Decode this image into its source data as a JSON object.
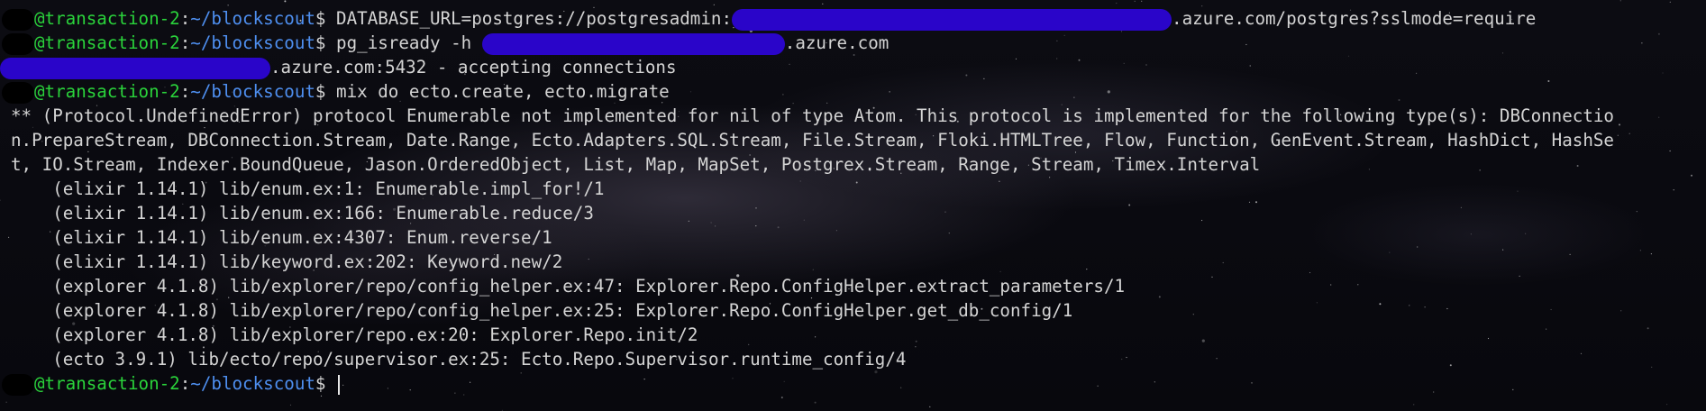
{
  "terminal": {
    "user": "@transaction-2",
    "cwd": "~/blockscout",
    "prompt_symbol": "$",
    "colors": {
      "user": "#2ad33b",
      "path": "#4e8ff0",
      "text": "#d4d4d4",
      "redaction": "#2a05c9"
    },
    "line1": {
      "cmd_a": "DATABASE_URL=postgres://postgresadmin:",
      "cmd_b": ".azure.com/postgres?sslmode=require"
    },
    "line2": {
      "cmd_a": "pg_isready -h ",
      "cmd_b": ".azure.com"
    },
    "line3": {
      "text": ".azure.com:5432 - accepting connections"
    },
    "line4": {
      "cmd": "mix do ecto.create, ecto.migrate"
    },
    "error_lines": [
      "** (Protocol.UndefinedError) protocol Enumerable not implemented for nil of type Atom. This protocol is implemented for the following type(s): DBConnectio",
      "n.PrepareStream, DBConnection.Stream, Date.Range, Ecto.Adapters.SQL.Stream, File.Stream, Floki.HTMLTree, Flow, Function, GenEvent.Stream, HashDict, HashSe",
      "t, IO.Stream, Indexer.BoundQueue, Jason.OrderedObject, List, Map, MapSet, Postgrex.Stream, Range, Stream, Timex.Interval"
    ],
    "stack": [
      "    (elixir 1.14.1) lib/enum.ex:1: Enumerable.impl_for!/1",
      "    (elixir 1.14.1) lib/enum.ex:166: Enumerable.reduce/3",
      "    (elixir 1.14.1) lib/enum.ex:4307: Enum.reverse/1",
      "    (elixir 1.14.1) lib/keyword.ex:202: Keyword.new/2",
      "    (explorer 4.1.8) lib/explorer/repo/config_helper.ex:47: Explorer.Repo.ConfigHelper.extract_parameters/1",
      "    (explorer 4.1.8) lib/explorer/repo/config_helper.ex:25: Explorer.Repo.ConfigHelper.get_db_config/1",
      "    (explorer 4.1.8) lib/explorer/repo.ex:20: Explorer.Repo.init/2",
      "    (ecto 3.9.1) lib/ecto/repo/supervisor.ex:25: Ecto.Repo.Supervisor.runtime_config/4"
    ]
  }
}
